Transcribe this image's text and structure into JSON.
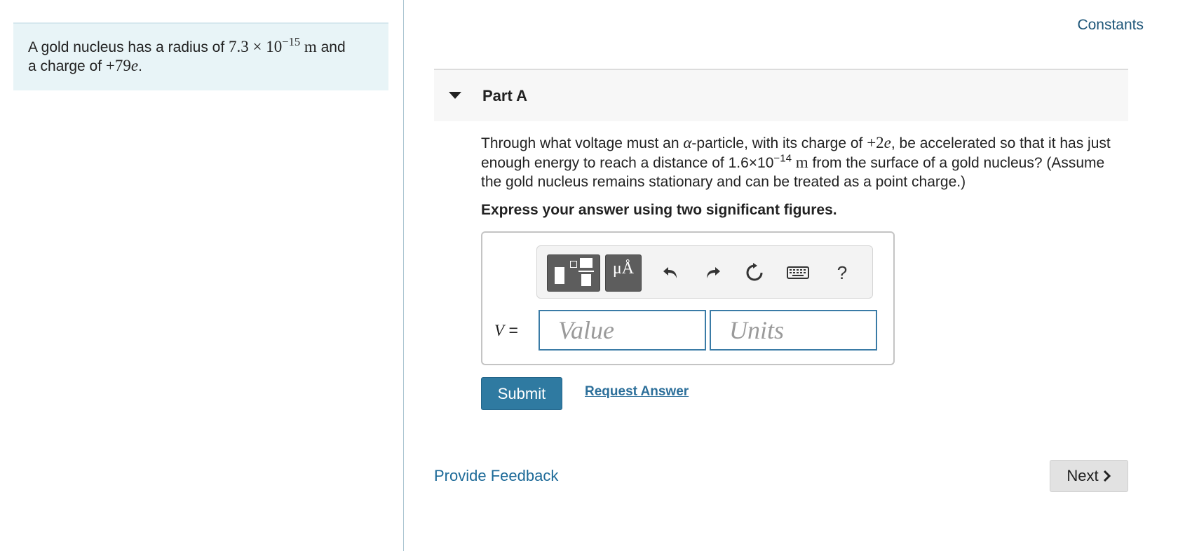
{
  "intro": {
    "text_before_radius": "A gold nucleus has a radius of ",
    "radius_mantissa": "7.3",
    "times": " × 10",
    "radius_exponent": "−15",
    "radius_unit": " m",
    "text_and": " and",
    "text_charge": "a charge of ",
    "charge_value": "+79",
    "charge_symbol": "e",
    "period": "."
  },
  "constants_link": "Constants",
  "part": {
    "title": "Part A"
  },
  "question": {
    "t1": "Through what voltage must an ",
    "alpha": "α",
    "t2": "-particle, with its charge of ",
    "charge_value": "+2",
    "charge_symbol": "e",
    "t3": ", be accelerated so that it has just enough energy to reach a distance of 1.6×10",
    "exponent": "−14",
    "unit": " m",
    "t4": " from the surface of a gold nucleus? (Assume the gold nucleus remains stationary and can be treated as a point charge.)"
  },
  "instruction": "Express your answer using two significant figures.",
  "toolbar": {
    "units_label": "μÅ",
    "help_label": "?",
    "icons": [
      "templates-icon",
      "units-icon",
      "undo-icon",
      "redo-icon",
      "reset-icon",
      "keyboard-icon",
      "help-icon"
    ]
  },
  "answer": {
    "variable": "V",
    "equals": " =",
    "value_placeholder": "Value",
    "units_placeholder": "Units"
  },
  "buttons": {
    "submit": "Submit",
    "request_answer": "Request Answer",
    "next": "Next"
  },
  "feedback_link": "Provide Feedback",
  "colors": {
    "accent": "#2f7aa1",
    "link": "#1d6a98",
    "left_panel_bg": "#e8f4f7",
    "part_header_bg": "#f7f7f7"
  }
}
